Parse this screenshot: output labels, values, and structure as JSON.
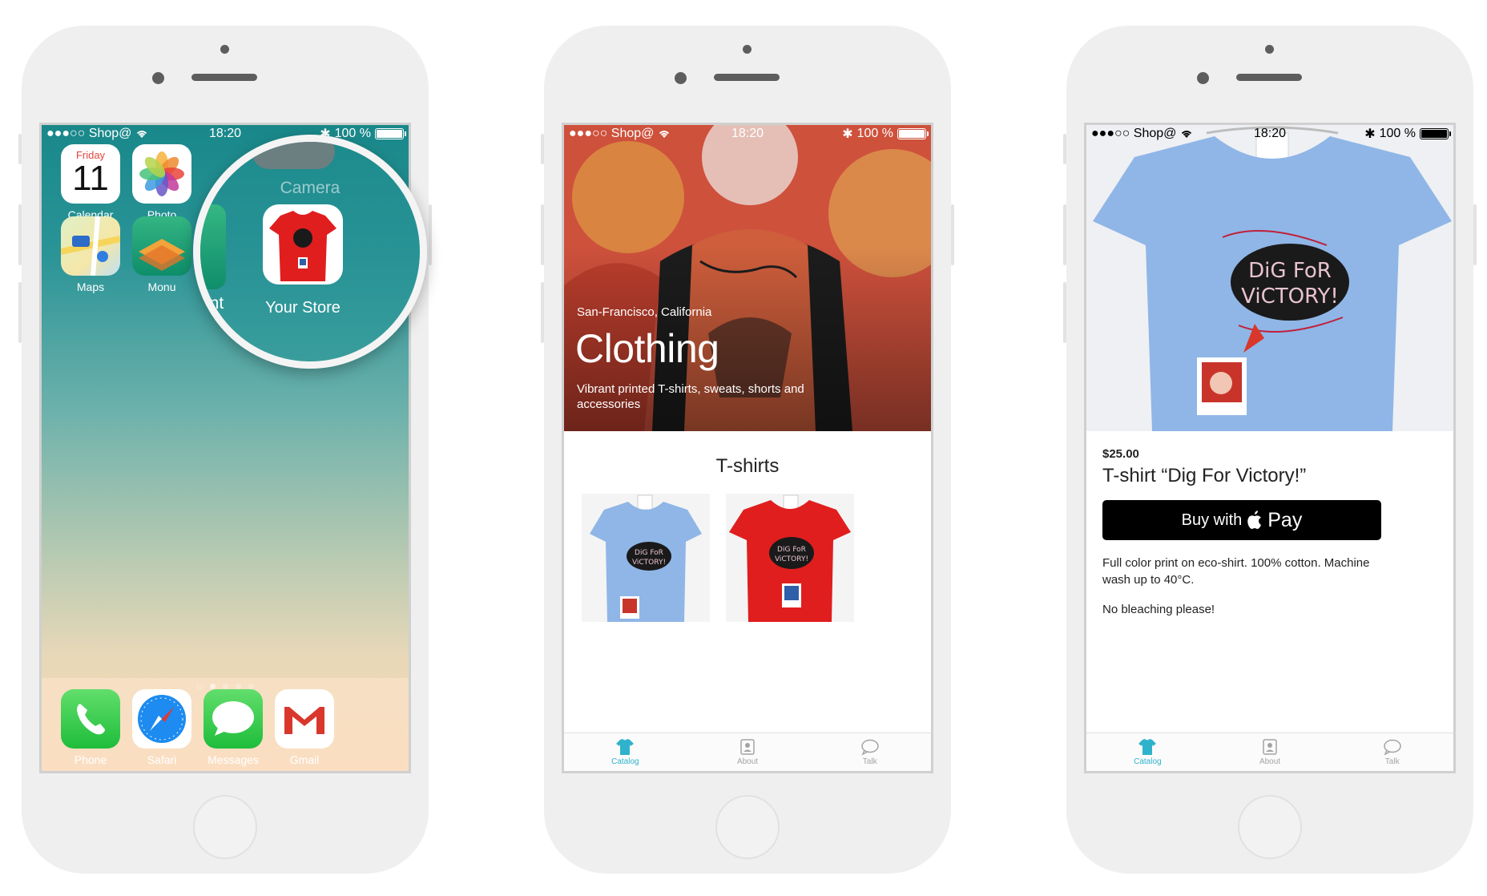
{
  "status_bar": {
    "carrier": "●●●○○ Shop@",
    "time": "18:20",
    "battery": "100 %"
  },
  "home_screen": {
    "apps": [
      {
        "label": "Calendar",
        "icon": "calendar-icon",
        "day": "Friday",
        "date": "11"
      },
      {
        "label": "Photo",
        "icon": "photos-icon"
      },
      {
        "label": "Maps",
        "icon": "maps-icon"
      },
      {
        "label": "Monu",
        "icon": "monument-icon"
      }
    ],
    "dock": [
      {
        "label": "Phone",
        "icon": "phone-icon"
      },
      {
        "label": "Safari",
        "icon": "safari-icon"
      },
      {
        "label": "Messages",
        "icon": "messages-icon"
      },
      {
        "label": "Gmail",
        "icon": "gmail-icon"
      }
    ],
    "magnifier": {
      "camera_label": "Camera",
      "partial_label": "ent",
      "store_label": "Your Store"
    }
  },
  "catalog": {
    "hero_location": "San-Francisco, California",
    "hero_title": "Clothing",
    "hero_subtitle": "Vibrant printed T-shirts, sweats, shorts and accessories",
    "section_title": "T-shirts"
  },
  "product": {
    "price": "$25.00",
    "title": "T-shirt “Dig For Victory!”",
    "buy_label": "Buy with",
    "pay_word": "Pay",
    "description": "Full color print on eco-shirt. 100% cotton. Machine wash up to 40°C.",
    "note": "No bleaching please!",
    "print_text_1": "DiG FoR",
    "print_text_2": "ViCTORY!"
  },
  "tab_bar": {
    "catalog": "Catalog",
    "about": "About",
    "talk": "Talk"
  },
  "colors": {
    "accent": "#2fb2cc",
    "tshirt_blue": "#8fb6e6",
    "tshirt_red": "#e01e1e"
  }
}
